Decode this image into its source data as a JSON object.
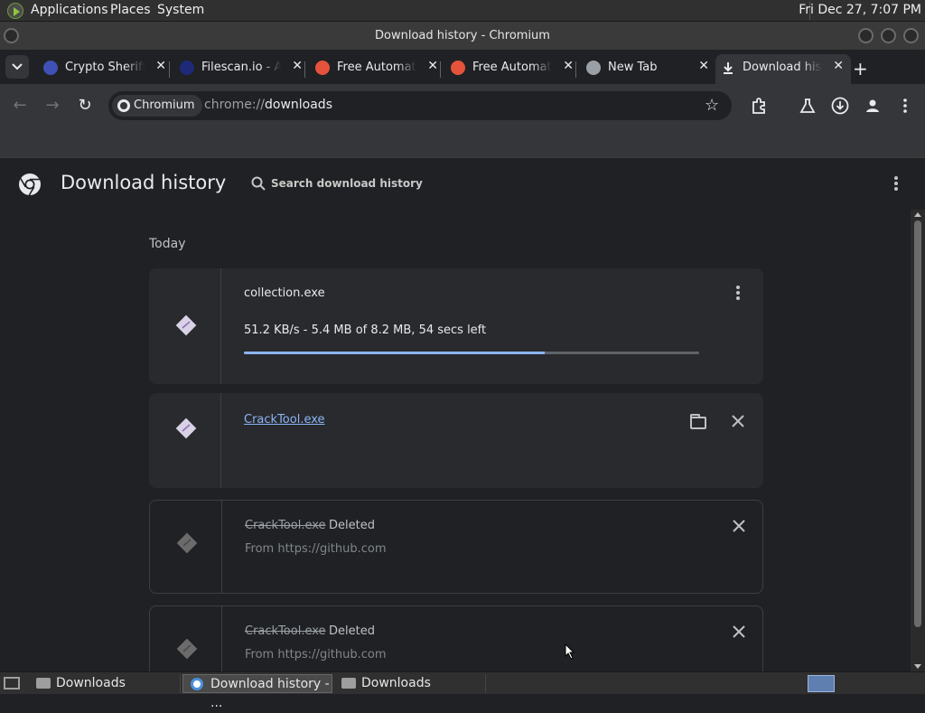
{
  "top_panel": {
    "menus": [
      "Applications",
      "Places",
      "System"
    ],
    "clock": "Fri Dec 27,  7:07 PM"
  },
  "window": {
    "title": "Download history - Chromium"
  },
  "tabs": [
    {
      "title": "Crypto Sherifi",
      "favicon_color": "#3f51b5",
      "active": false
    },
    {
      "title": "Filescan.io - A",
      "favicon_color": "#1e2a78",
      "active": false
    },
    {
      "title": "Free Automat",
      "favicon_color": "#e5533d",
      "active": false
    },
    {
      "title": "Free Automat",
      "favicon_color": "#e5533d",
      "active": false
    },
    {
      "title": "New Tab",
      "favicon_color": "#9aa0a6",
      "active": false
    },
    {
      "title": "Download his",
      "favicon_color": "#e8eaed",
      "active": true
    }
  ],
  "omnibox": {
    "site_chip": "Chromium",
    "url_prefix": "chrome://",
    "url_host": "downloads"
  },
  "page": {
    "title": "Download history",
    "search_placeholder": "Search download history",
    "section": "Today"
  },
  "downloads": [
    {
      "filename": "collection.exe",
      "status": "51.2 KB/s - 5.4 MB of 8.2 MB, 54 secs left",
      "progress": 0.66
    },
    {
      "filename": "CrackTool.exe"
    },
    {
      "filename": "CrackTool.exe",
      "state": "Deleted",
      "from": "From https://github.com"
    },
    {
      "filename": "CrackTool.exe",
      "state": "Deleted",
      "from": "From https://github.com"
    }
  ],
  "taskbar": {
    "items": [
      "Downloads",
      "Download history - ...",
      "Downloads"
    ]
  },
  "colors": {
    "accent": "#8ab4f8",
    "background": "#202124",
    "card": "#292a2d"
  }
}
